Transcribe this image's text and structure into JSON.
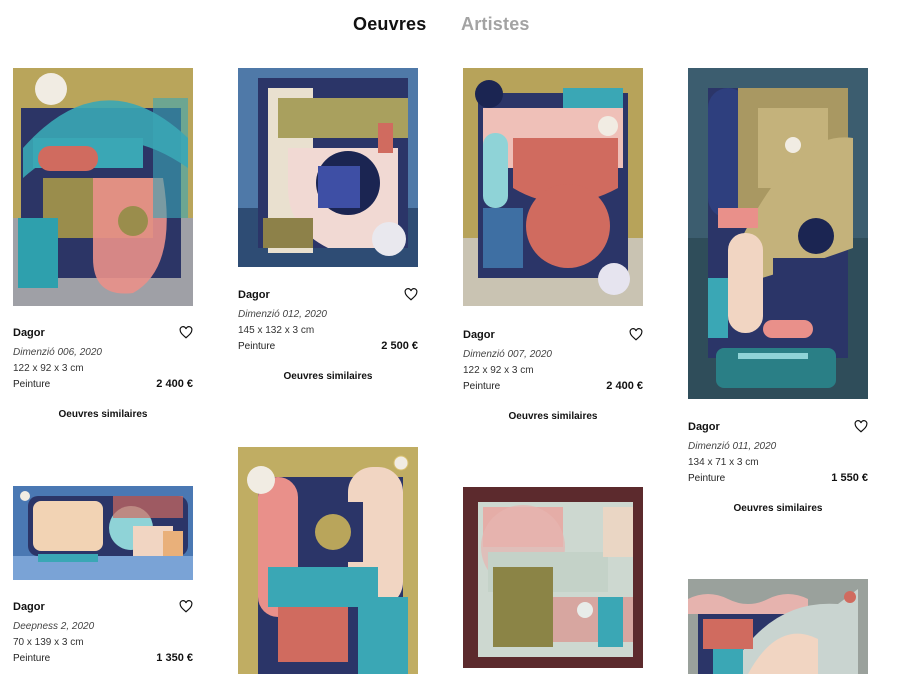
{
  "nav": {
    "tab_works": "Oeuvres",
    "tab_artists": "Artistes"
  },
  "cards": [
    {
      "artist": "Dagor",
      "title": "Dimenzió 006, 2020",
      "dims": "122 x 92 x 3 cm",
      "medium": "Peinture",
      "price": "2 400 €",
      "similar": "Oeuvres similaires"
    },
    {
      "artist": "Dagor",
      "title": "Dimenzió 012, 2020",
      "dims": "145 x 132 x 3 cm",
      "medium": "Peinture",
      "price": "2 500 €",
      "similar": "Oeuvres similaires"
    },
    {
      "artist": "Dagor",
      "title": "Dimenzió 007, 2020",
      "dims": "122 x 92 x 3 cm",
      "medium": "Peinture",
      "price": "2 400 €",
      "similar": "Oeuvres similaires"
    },
    {
      "artist": "Dagor",
      "title": "Dimenzió 011, 2020",
      "dims": "134 x 71 x 3 cm",
      "medium": "Peinture",
      "price": "1 550 €",
      "similar": "Oeuvres similaires"
    },
    {
      "artist": "Dagor",
      "title": "Deepness 2, 2020",
      "dims": "70 x 139 x 3 cm",
      "medium": "Peinture",
      "price": "1 350 €"
    }
  ],
  "colors": {
    "tab_active": "#111111",
    "tab_inactive": "#a3a3a3",
    "mustard": "#b7a35a",
    "navy": "#2b3568",
    "teal": "#3aa7b5",
    "salmon": "#e9908a",
    "coral": "#cc5f55",
    "cream": "#f1d5c2"
  },
  "icons": {
    "favorite": "heart-outline-icon"
  }
}
